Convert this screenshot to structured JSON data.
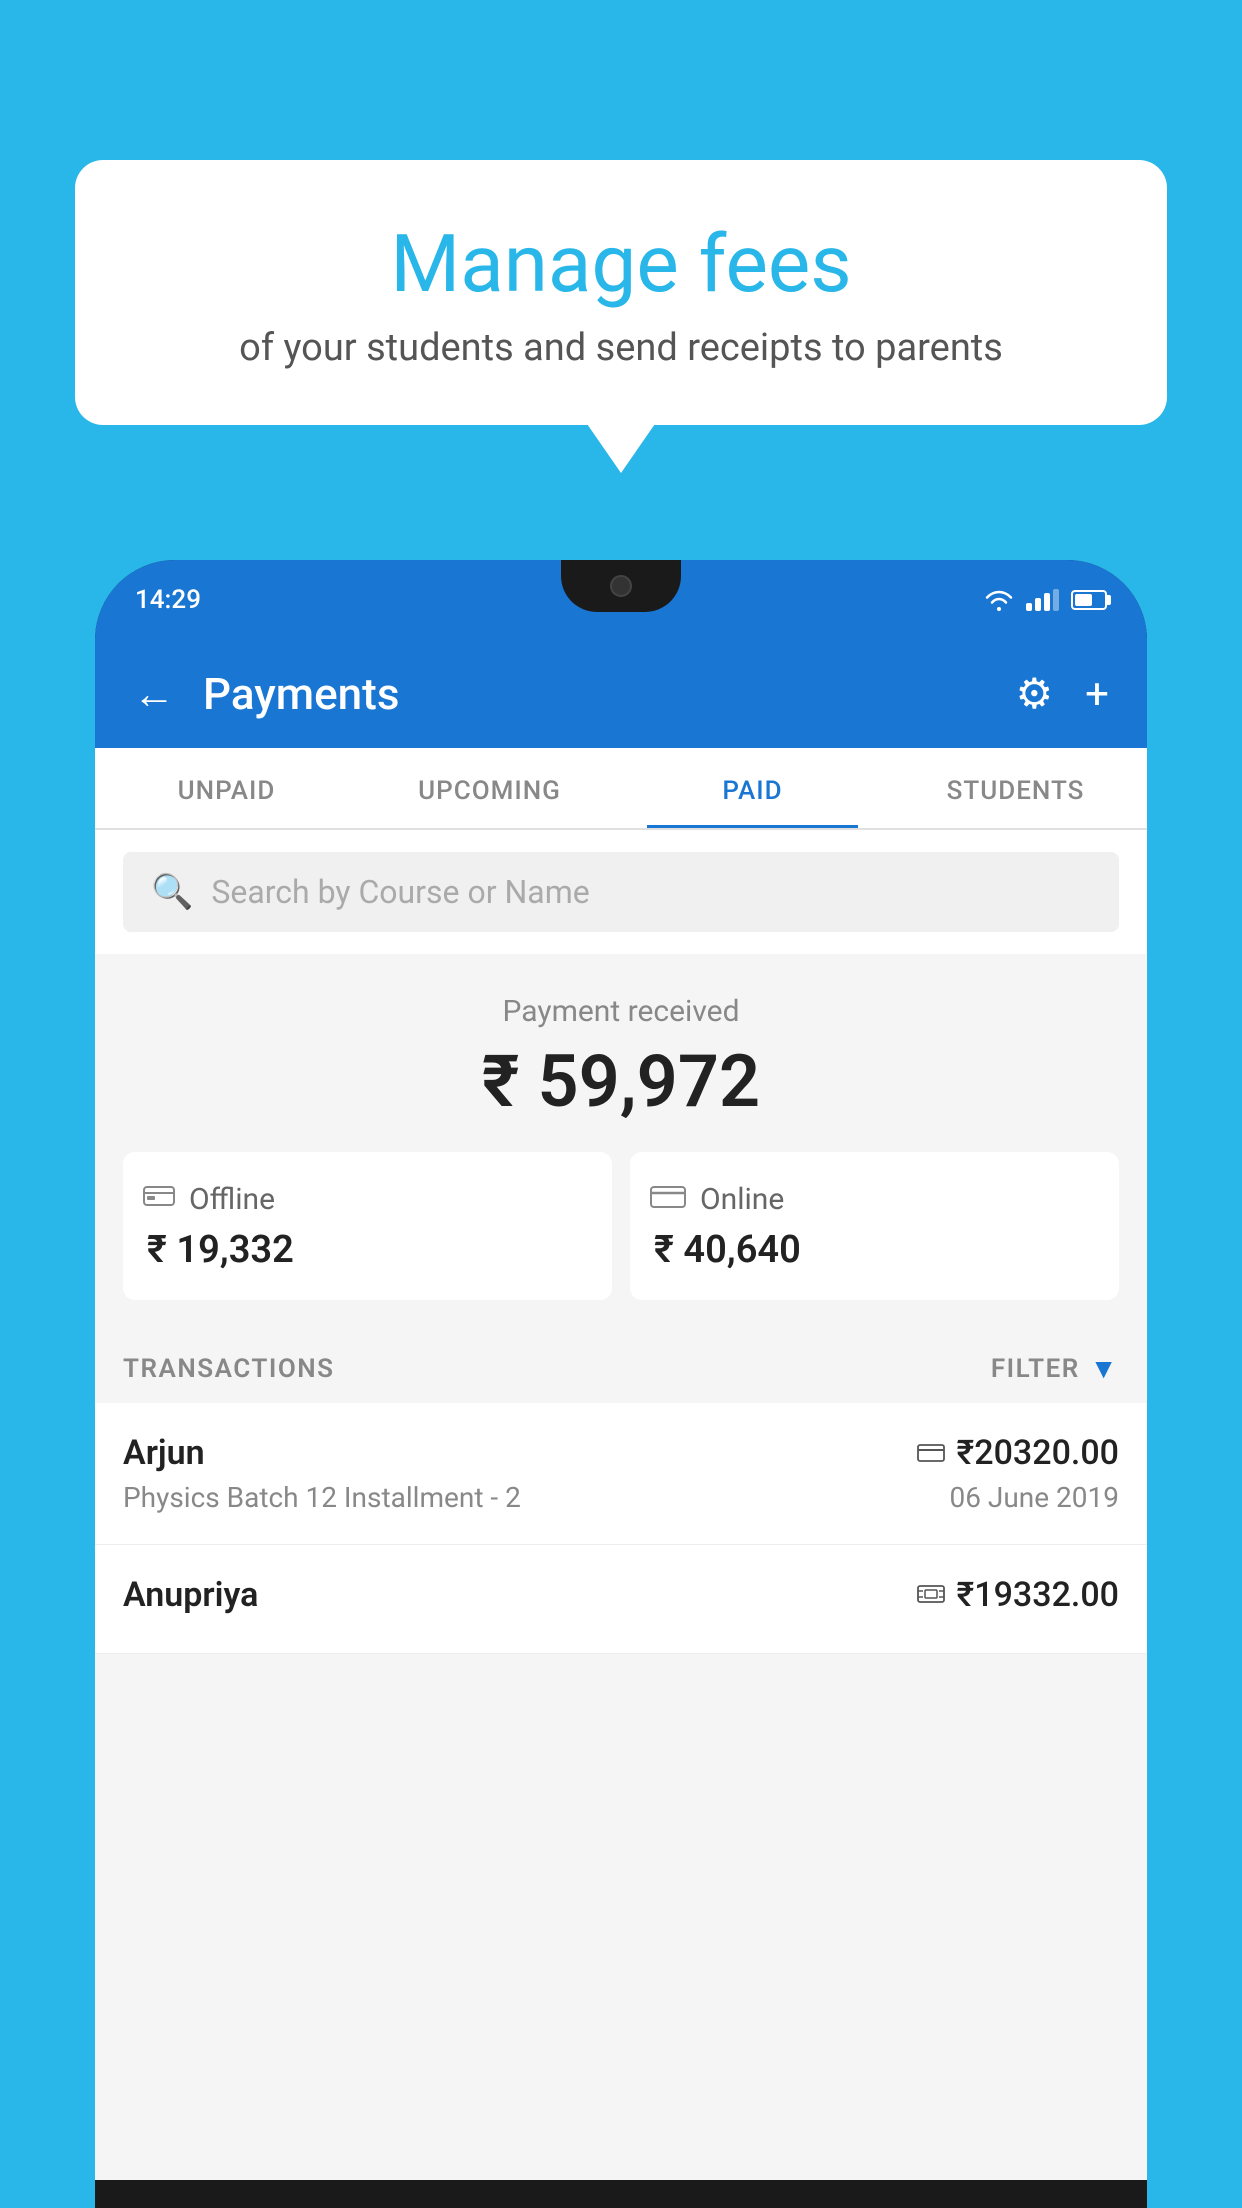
{
  "background_color": "#29b6e8",
  "speech_bubble": {
    "title": "Manage fees",
    "subtitle": "of your students and send receipts to parents"
  },
  "status_bar": {
    "time": "14:29"
  },
  "header": {
    "title": "Payments",
    "back_label": "←",
    "settings_label": "⚙",
    "add_label": "+"
  },
  "tabs": [
    {
      "label": "UNPAID",
      "active": false
    },
    {
      "label": "UPCOMING",
      "active": false
    },
    {
      "label": "PAID",
      "active": true
    },
    {
      "label": "STUDENTS",
      "active": false
    }
  ],
  "search": {
    "placeholder": "Search by Course or Name"
  },
  "payment_summary": {
    "label": "Payment received",
    "total": "₹ 59,972",
    "offline": {
      "type": "Offline",
      "amount": "₹ 19,332"
    },
    "online": {
      "type": "Online",
      "amount": "₹ 40,640"
    }
  },
  "transactions": {
    "section_label": "TRANSACTIONS",
    "filter_label": "FILTER",
    "rows": [
      {
        "name": "Arjun",
        "description": "Physics Batch 12 Installment - 2",
        "amount": "₹20320.00",
        "date": "06 June 2019",
        "payment_type": "card"
      },
      {
        "name": "Anupriya",
        "description": "",
        "amount": "₹19332.00",
        "date": "",
        "payment_type": "cash"
      }
    ]
  }
}
